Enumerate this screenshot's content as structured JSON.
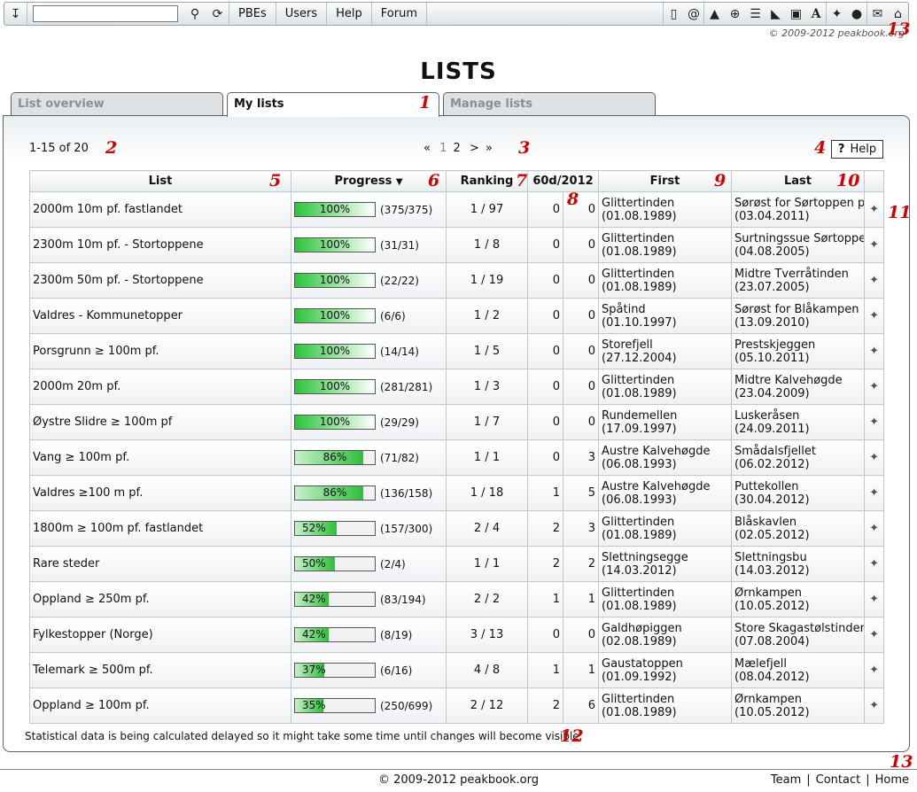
{
  "toolbar": {
    "search_value": "",
    "nav": [
      "PBEs",
      "Users",
      "Help",
      "Forum"
    ],
    "right_icons": [
      "mobile-icon",
      "at-icon",
      "mountain-icon",
      "globe-icon",
      "list-icon",
      "boot-icon",
      "picture-icon",
      "font-icon",
      "pushpin-icon",
      "ball-icon",
      "mail-icon",
      "home-icon"
    ],
    "copyright": "© 2009-2012 peakbook.org"
  },
  "page_title": "LISTS",
  "tabs": [
    {
      "label": "List overview",
      "active": false
    },
    {
      "label": "My lists",
      "active": true
    },
    {
      "label": "Manage lists",
      "active": false
    }
  ],
  "pager": {
    "info": "1-15 of 20",
    "prev": "«",
    "pages": [
      "1",
      "2"
    ],
    "next": ">",
    "last": "»"
  },
  "help_label": "Help",
  "table": {
    "headers": {
      "list": "List",
      "progress": "Progress",
      "ranking": "Ranking",
      "period": "60d/2012",
      "first": "First",
      "last": "Last"
    },
    "rows": [
      {
        "list": "2000m 10m pf. fastlandet",
        "pct": 100,
        "pct_label": "100%",
        "counts": "(375/375)",
        "ranking": "1 / 97",
        "d60": "0",
        "y2012": "0",
        "first_name": "Glittertinden",
        "first_date": "(01.08.1989)",
        "last_name": "Sørøst for Sørtoppen på",
        "last_date": "(03.04.2011)"
      },
      {
        "list": "2300m 10m pf. - Stortoppene",
        "pct": 100,
        "pct_label": "100%",
        "counts": "(31/31)",
        "ranking": "1 / 8",
        "d60": "0",
        "y2012": "0",
        "first_name": "Glittertinden",
        "first_date": "(01.08.1989)",
        "last_name": "Surtningssue Sørtoppen",
        "last_date": "(04.08.2005)"
      },
      {
        "list": "2300m 50m pf. - Stortoppene",
        "pct": 100,
        "pct_label": "100%",
        "counts": "(22/22)",
        "ranking": "1 / 19",
        "d60": "0",
        "y2012": "0",
        "first_name": "Glittertinden",
        "first_date": "(01.08.1989)",
        "last_name": "Midtre Tverråtinden",
        "last_date": "(23.07.2005)"
      },
      {
        "list": "Valdres - Kommunetopper",
        "pct": 100,
        "pct_label": "100%",
        "counts": "(6/6)",
        "ranking": "1 / 2",
        "d60": "0",
        "y2012": "0",
        "first_name": "Spåtind",
        "first_date": "(01.10.1997)",
        "last_name": "Sørøst for Blåkampen",
        "last_date": "(13.09.2010)"
      },
      {
        "list": "Porsgrunn ≥ 100m pf.",
        "pct": 100,
        "pct_label": "100%",
        "counts": "(14/14)",
        "ranking": "1 / 5",
        "d60": "0",
        "y2012": "0",
        "first_name": "Storefjell",
        "first_date": "(27.12.2004)",
        "last_name": "Prestskjeggen",
        "last_date": "(05.10.2011)"
      },
      {
        "list": "2000m 20m pf.",
        "pct": 100,
        "pct_label": "100%",
        "counts": "(281/281)",
        "ranking": "1 / 3",
        "d60": "0",
        "y2012": "0",
        "first_name": "Glittertinden",
        "first_date": "(01.08.1989)",
        "last_name": "Midtre Kalvehøgde",
        "last_date": "(23.04.2009)"
      },
      {
        "list": "Øystre Slidre ≥ 100m pf",
        "pct": 100,
        "pct_label": "100%",
        "counts": "(29/29)",
        "ranking": "1 / 7",
        "d60": "0",
        "y2012": "0",
        "first_name": "Rundemellen",
        "first_date": "(17.09.1997)",
        "last_name": "Luskeråsen",
        "last_date": "(24.09.2011)"
      },
      {
        "list": "Vang ≥ 100m pf.",
        "pct": 86,
        "pct_label": "86%",
        "counts": "(71/82)",
        "ranking": "1 / 1",
        "d60": "0",
        "y2012": "3",
        "first_name": "Austre Kalvehøgde",
        "first_date": "(06.08.1993)",
        "last_name": "Smådalsfjellet",
        "last_date": "(06.02.2012)"
      },
      {
        "list": "Valdres ≥100 m pf.",
        "pct": 86,
        "pct_label": "86%",
        "counts": "(136/158)",
        "ranking": "1 / 18",
        "d60": "1",
        "y2012": "5",
        "first_name": "Austre Kalvehøgde",
        "first_date": "(06.08.1993)",
        "last_name": "Puttekollen",
        "last_date": "(30.04.2012)"
      },
      {
        "list": "1800m ≥ 100m pf. fastlandet",
        "pct": 52,
        "pct_label": "52%",
        "counts": "(157/300)",
        "ranking": "2 / 4",
        "d60": "2",
        "y2012": "3",
        "first_name": "Glittertinden",
        "first_date": "(01.08.1989)",
        "last_name": "Blåskavlen",
        "last_date": "(02.05.2012)"
      },
      {
        "list": "Rare steder",
        "pct": 50,
        "pct_label": "50%",
        "counts": "(2/4)",
        "ranking": "1 / 1",
        "d60": "2",
        "y2012": "2",
        "first_name": "Slettningsegge",
        "first_date": "(14.03.2012)",
        "last_name": "Slettningsbu",
        "last_date": "(14.03.2012)"
      },
      {
        "list": "Oppland ≥ 250m pf.",
        "pct": 42,
        "pct_label": "42%",
        "counts": "(83/194)",
        "ranking": "2 / 2",
        "d60": "1",
        "y2012": "1",
        "first_name": "Glittertinden",
        "first_date": "(01.08.1989)",
        "last_name": "Ørnkampen",
        "last_date": "(10.05.2012)"
      },
      {
        "list": "Fylkestopper (Norge)",
        "pct": 42,
        "pct_label": "42%",
        "counts": "(8/19)",
        "ranking": "3 / 13",
        "d60": "0",
        "y2012": "0",
        "first_name": "Galdhøpiggen",
        "first_date": "(02.08.1989)",
        "last_name": "Store Skagastølstinden",
        "last_date": "(07.08.2004)"
      },
      {
        "list": "Telemark ≥ 500m pf.",
        "pct": 37,
        "pct_label": "37%",
        "counts": "(6/16)",
        "ranking": "4 / 8",
        "d60": "1",
        "y2012": "1",
        "first_name": "Gaustatoppen",
        "first_date": "(01.09.1992)",
        "last_name": "Mælefjell",
        "last_date": "(08.04.2012)"
      },
      {
        "list": "Oppland ≥ 100m pf.",
        "pct": 35,
        "pct_label": "35%",
        "counts": "(250/699)",
        "ranking": "2 / 12",
        "d60": "2",
        "y2012": "6",
        "first_name": "Glittertinden",
        "first_date": "(01.08.1989)",
        "last_name": "Ørnkampen",
        "last_date": "(10.05.2012)"
      }
    ]
  },
  "stat_note": "Statistical data is being calculated delayed so it might take some time until changes will become visible.",
  "footer": {
    "copyright": "© 2009-2012 peakbook.org",
    "links": [
      "Team",
      "Contact",
      "Home"
    ]
  },
  "markers": [
    "1",
    "2",
    "3",
    "4",
    "5",
    "6",
    "7",
    "8",
    "9",
    "10",
    "11",
    "12",
    "13",
    "13"
  ],
  "colors": {
    "bar_green": "#2cc43a",
    "marker_red": "#d40000"
  }
}
